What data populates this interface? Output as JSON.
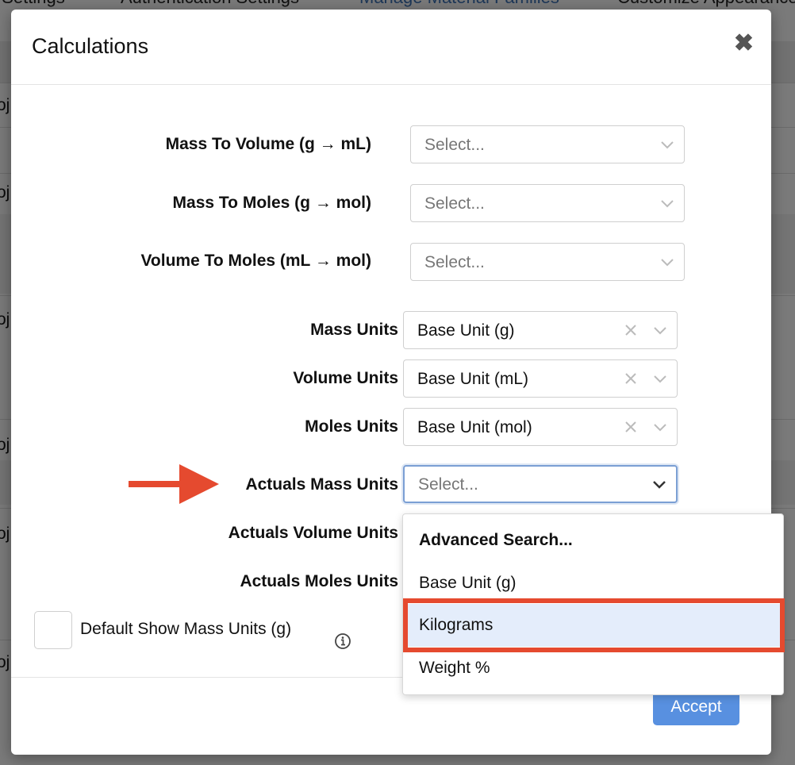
{
  "background": {
    "tabs": [
      "t Settings",
      "Authentication Settings",
      "Manage Material Families",
      "Customize Appearance"
    ],
    "row_fragment": "oj"
  },
  "modal": {
    "title": "Calculations",
    "close_icon": "close-icon",
    "conversions": [
      {
        "label": "Mass To Volume (g → mL)",
        "placeholder": "Select..."
      },
      {
        "label": "Mass To Moles (g → mol)",
        "placeholder": "Select..."
      },
      {
        "label": "Volume To Moles (mL → mol)",
        "placeholder": "Select..."
      }
    ],
    "units": [
      {
        "label": "Mass Units",
        "value": "Base Unit (g)"
      },
      {
        "label": "Volume Units",
        "value": "Base Unit (mL)"
      },
      {
        "label": "Moles Units",
        "value": "Base Unit (mol)"
      }
    ],
    "actuals": [
      {
        "label": "Actuals Mass Units",
        "placeholder": "Select..."
      },
      {
        "label": "Actuals Volume Units"
      },
      {
        "label": "Actuals Moles Units"
      }
    ],
    "checkbox": {
      "label": "Default Show Mass Units (g)",
      "checked": false,
      "info_icon": "info-icon"
    },
    "accept_label": "Accept"
  },
  "dropdown": {
    "options": [
      "Advanced Search...",
      "Base Unit (g)",
      "Kilograms",
      "Weight %"
    ],
    "hovered": "Kilograms"
  },
  "annotations": {
    "arrow_color": "#e54a2f",
    "highlight_color": "#e54a2f"
  },
  "colors": {
    "accent": "#5890e0",
    "focus_border": "#7b9fd4",
    "hover_bg": "#e4edfb"
  }
}
